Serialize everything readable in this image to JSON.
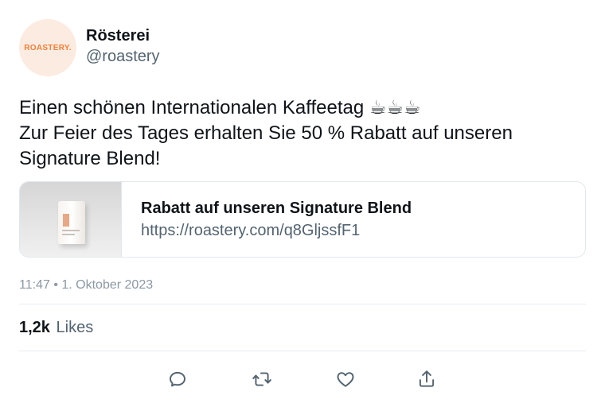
{
  "account": {
    "avatar_text": "ROASTERY.",
    "display_name": "Rösterei",
    "handle": "@roastery"
  },
  "tweet": {
    "lines": [
      "Einen schönen Internationalen Kaffeetag ☕☕☕",
      "Zur Feier des Tages erhalten Sie 50 % Rabatt auf unseren",
      "Signature Blend!"
    ],
    "time": "11:47",
    "separator": "•",
    "date": "1. Oktober 2023"
  },
  "card": {
    "title": "Rabatt auf unseren Signature Blend",
    "url": "https://roastery.com/q8GljssfF1",
    "image": "product-bag"
  },
  "stats": {
    "likes_count": "1,2k",
    "likes_label": "Likes"
  },
  "actions": {
    "icons": [
      "reply-icon",
      "retweet-icon",
      "like-icon",
      "share-icon"
    ]
  },
  "colors": {
    "text": "#0f1419",
    "secondary": "#536471",
    "meta": "#8b98a5",
    "avatar_bg": "#fcebe0",
    "avatar_accent": "#f07f38",
    "border": "#e1e8ed"
  }
}
